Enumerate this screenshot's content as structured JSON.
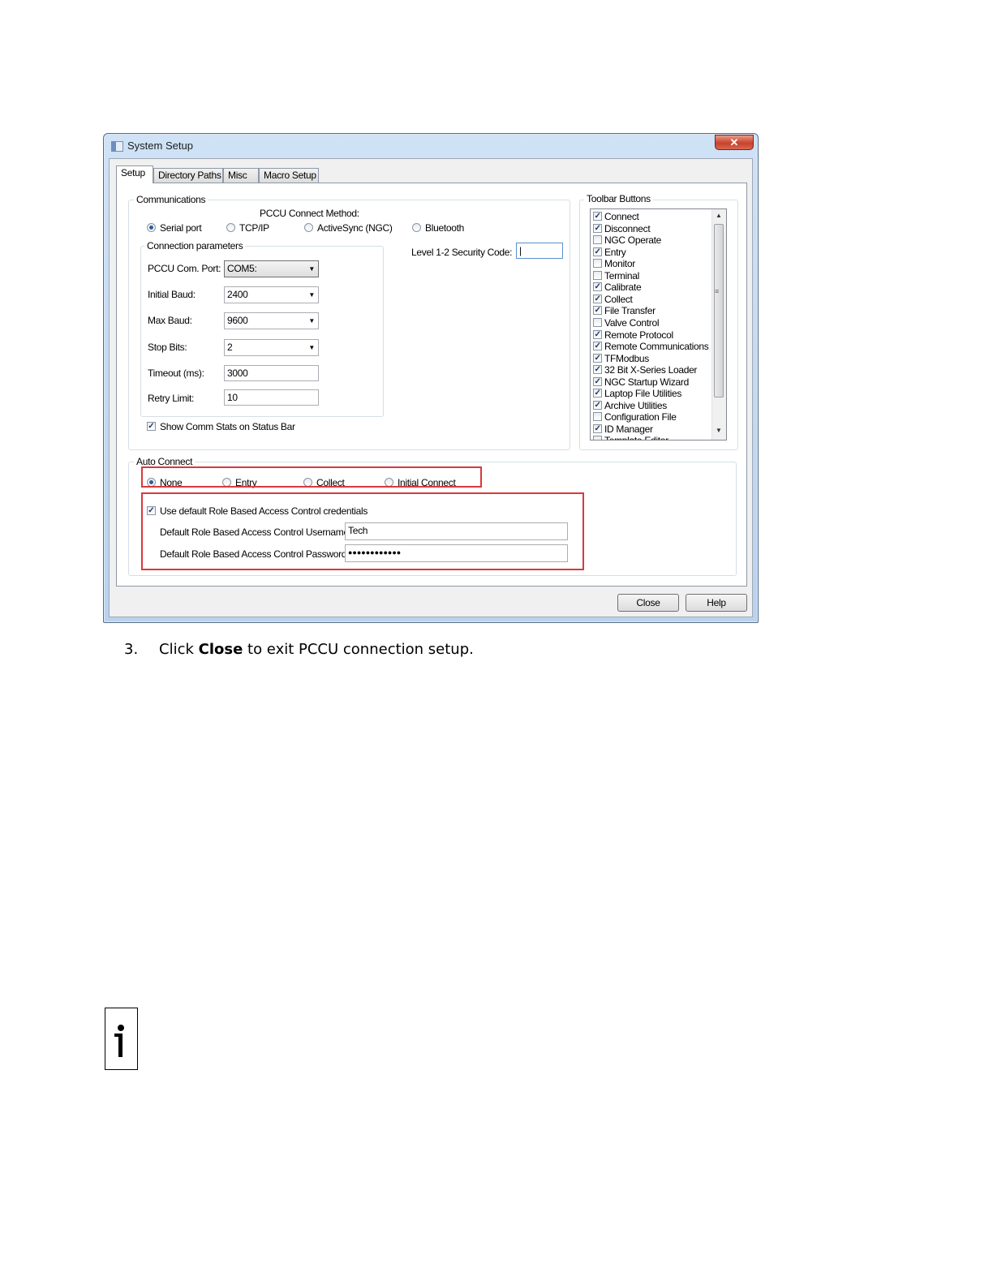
{
  "window": {
    "title": "System Setup",
    "close_glyph": "✕"
  },
  "tabs": [
    "Setup",
    "Directory Paths",
    "Misc",
    "Macro Setup"
  ],
  "communications": {
    "legend": "Communications",
    "method_label": "PCCU Connect Method:",
    "methods": [
      "Serial port",
      "TCP/IP",
      "ActiveSync (NGC)",
      "Bluetooth"
    ],
    "selected_method": "Serial port",
    "security_label": "Level 1-2 Security Code:",
    "security_value": "|",
    "conn_params": {
      "legend": "Connection parameters",
      "com_port_label": "PCCU Com. Port:",
      "com_port_value": "COM5:",
      "initial_baud_label": "Initial Baud:",
      "initial_baud_value": "2400",
      "max_baud_label": "Max Baud:",
      "max_baud_value": "9600",
      "stop_bits_label": "Stop Bits:",
      "stop_bits_value": "2",
      "timeout_label": "Timeout (ms):",
      "timeout_value": "3000",
      "retry_label": "Retry Limit:",
      "retry_value": "10"
    },
    "show_comm_stats_label": "Show Comm Stats on Status Bar",
    "show_comm_stats_checked": true
  },
  "toolbar_buttons": {
    "legend": "Toolbar Buttons",
    "items": [
      {
        "label": "Connect",
        "checked": true
      },
      {
        "label": "Disconnect",
        "checked": true
      },
      {
        "label": "NGC Operate",
        "checked": false
      },
      {
        "label": "Entry",
        "checked": true
      },
      {
        "label": "Monitor",
        "checked": false
      },
      {
        "label": "Terminal",
        "checked": false
      },
      {
        "label": "Calibrate",
        "checked": true
      },
      {
        "label": "Collect",
        "checked": true
      },
      {
        "label": "File Transfer",
        "checked": true
      },
      {
        "label": "Valve Control",
        "checked": false
      },
      {
        "label": "Remote Protocol",
        "checked": true
      },
      {
        "label": "Remote Communications",
        "checked": true
      },
      {
        "label": "TFModbus",
        "checked": true
      },
      {
        "label": "32 Bit X-Series Loader",
        "checked": true
      },
      {
        "label": "NGC Startup Wizard",
        "checked": true
      },
      {
        "label": "Laptop File Utilities",
        "checked": true
      },
      {
        "label": "Archive Utilities",
        "checked": true
      },
      {
        "label": "Configuration File",
        "checked": false
      },
      {
        "label": "ID Manager",
        "checked": true
      },
      {
        "label": "Template Editor",
        "checked": false
      }
    ]
  },
  "auto_connect": {
    "legend": "Auto Connect",
    "options": [
      "None",
      "Entry",
      "Collect",
      "Initial Connect"
    ],
    "selected": "None",
    "rbac_checkbox_label": "Use default Role Based Access Control credentials",
    "rbac_checked": true,
    "username_label": "Default Role Based Access Control Username",
    "username_value": "Tech",
    "password_label": "Default Role Based Access Control Password",
    "password_value": "●●●●●●●●●●●●"
  },
  "buttons": {
    "close": "Close",
    "help": "Help"
  },
  "caption": {
    "number": "3.",
    "before": "Click ",
    "bold": "Close",
    "after": " to exit PCCU connection setup."
  },
  "colors": {
    "highlight_box": "#d9393c",
    "radio_dot": "#2e5d99"
  },
  "icons": [
    "app-window-icon",
    "close-icon",
    "dropdown-arrow-icon",
    "info-icon"
  ]
}
